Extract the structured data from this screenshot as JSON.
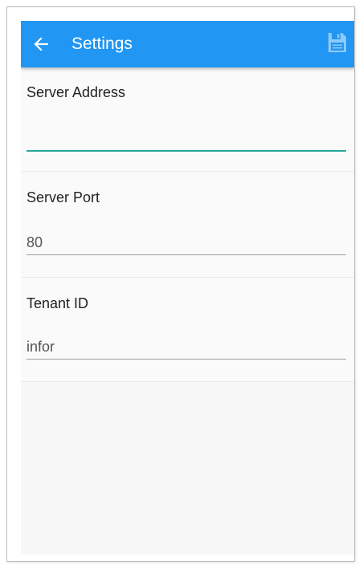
{
  "header": {
    "title": "Settings",
    "back_icon": "arrow-left-icon",
    "save_icon": "floppy-disk-icon",
    "background_color": "#2196f3"
  },
  "fields": [
    {
      "label": "Server Address",
      "value": "",
      "focused": true
    },
    {
      "label": "Server Port",
      "value": "80",
      "focused": false
    },
    {
      "label": "Tenant ID",
      "value": "infor",
      "focused": false
    }
  ],
  "colors": {
    "focus_underline": "#26a69a",
    "normal_underline": "#9e9e9e"
  }
}
